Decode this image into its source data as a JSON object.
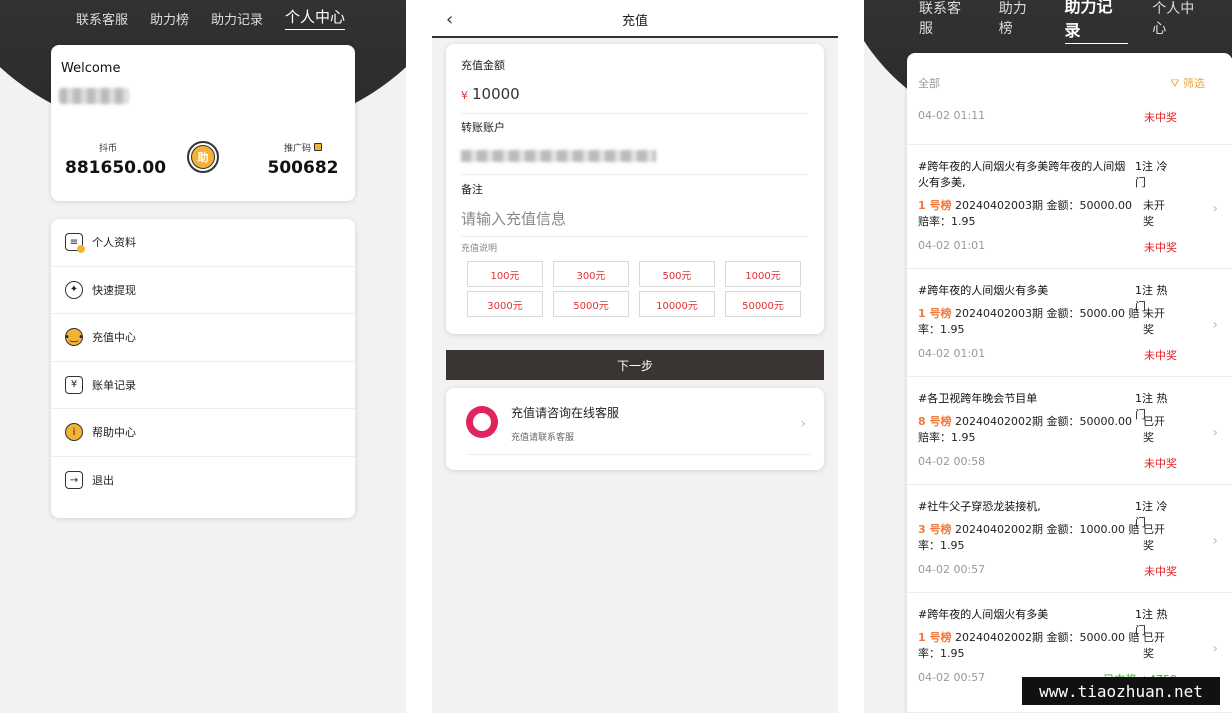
{
  "nav": {
    "items": [
      "联系客服",
      "助力榜",
      "助力记录",
      "个人中心"
    ]
  },
  "profile": {
    "welcome": "Welcome",
    "coin_label": "抖币",
    "coin_value": "881650.00",
    "coin_badge": "助",
    "promo_label": "推广码",
    "promo_value": "500682"
  },
  "menu": [
    "个人资料",
    "快速提现",
    "充值中心",
    "账单记录",
    "帮助中心",
    "退出"
  ],
  "recharge": {
    "title": "充值",
    "amount_label": "充值金额",
    "currency": "¥",
    "amount_value": "10000",
    "account_label": "转账账户",
    "remark_label": "备注",
    "remark_placeholder": "请输入充值信息",
    "notes_label": "充值说明",
    "amounts": [
      "100元",
      "300元",
      "500元",
      "1000元",
      "3000元",
      "5000元",
      "10000元",
      "50000元"
    ],
    "next_button": "下一步",
    "service_title": "充值请咨询在线客服",
    "service_sub": "充值请联系客服"
  },
  "records": {
    "filter_all": "全部",
    "filter_button": "筛选",
    "first_time": "04-02 01:11",
    "first_result": "未中奖",
    "items": [
      {
        "title": "#跨年夜的人间烟火有多美跨年夜的人间烟火有多美,",
        "tag": "1注 冷门",
        "rank": "1 号榜",
        "detail": " 20240402003期 金额：50000.00 赔率：1.95",
        "status": "未开奖",
        "time": "04-02 01:01",
        "result": "未中奖",
        "win": false
      },
      {
        "title": "#跨年夜的人间烟火有多美",
        "tag": "1注 热门",
        "rank": "1 号榜",
        "detail": " 20240402003期 金额：5000.00 赔率：1.95",
        "status": "未开奖",
        "time": "04-02 01:01",
        "result": "未中奖",
        "win": false
      },
      {
        "title": "#各卫视跨年晚会节目单",
        "tag": "1注 热门",
        "rank": "8 号榜",
        "detail": " 20240402002期 金额：50000.00 赔率：1.95",
        "status": "已开奖",
        "time": "04-02 00:58",
        "result": "未中奖",
        "win": false
      },
      {
        "title": "#社牛父子穿恐龙装接机,",
        "tag": "1注 冷门",
        "rank": "3 号榜",
        "detail": " 20240402002期 金额：1000.00 赔率：1.95",
        "status": "已开奖",
        "time": "04-02 00:57",
        "result": "未中奖",
        "win": false
      },
      {
        "title": "#跨年夜的人间烟火有多美",
        "tag": "1注 热门",
        "rank": "1 号榜",
        "detail": " 20240402002期 金额：5000.00 赔率：1.95",
        "status": "已开奖",
        "time": "04-02 00:57",
        "result": "已中奖 +4750",
        "win": true
      }
    ]
  },
  "watermark": "www.tiaozhuan.net",
  "colors": {
    "accent": "#f3a43a",
    "lose": "#e02020",
    "win": "#2fb12f",
    "dark": "#3a3432"
  }
}
